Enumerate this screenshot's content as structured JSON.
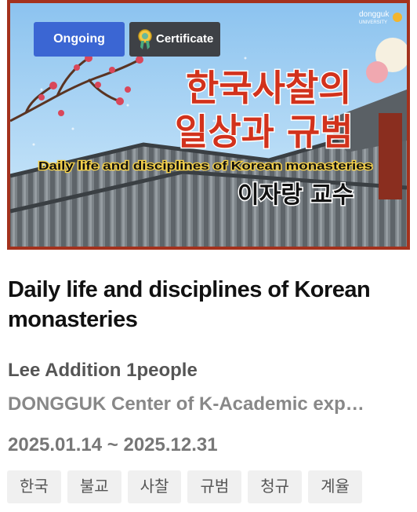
{
  "thumbnail": {
    "logo_top": "dongguk",
    "logo_bottom": "UNIVERSITY",
    "korean_title_line1": "한국사찰의",
    "korean_title_line2": "일상과 규범",
    "english_title": "Daily life and disciplines of Korean monasteries",
    "professor": "이자랑 교수"
  },
  "badges": {
    "status": "Ongoing",
    "certificate": "Certificate"
  },
  "course": {
    "title": "Daily life and disciplines of Korean monasteries",
    "instructor": "Lee Addition 1people",
    "organization": "DONGGUK Center of K-Academic exp…",
    "dates": "2025.01.14 ~ 2025.12.31"
  },
  "tags": [
    "한국",
    "불교",
    "사찰",
    "규범",
    "청규",
    "계율"
  ],
  "colors": {
    "ongoing": "#3b66d3",
    "certificate": "#3e4146",
    "frame": "#a4321d",
    "korean_title": "#d2321c"
  }
}
